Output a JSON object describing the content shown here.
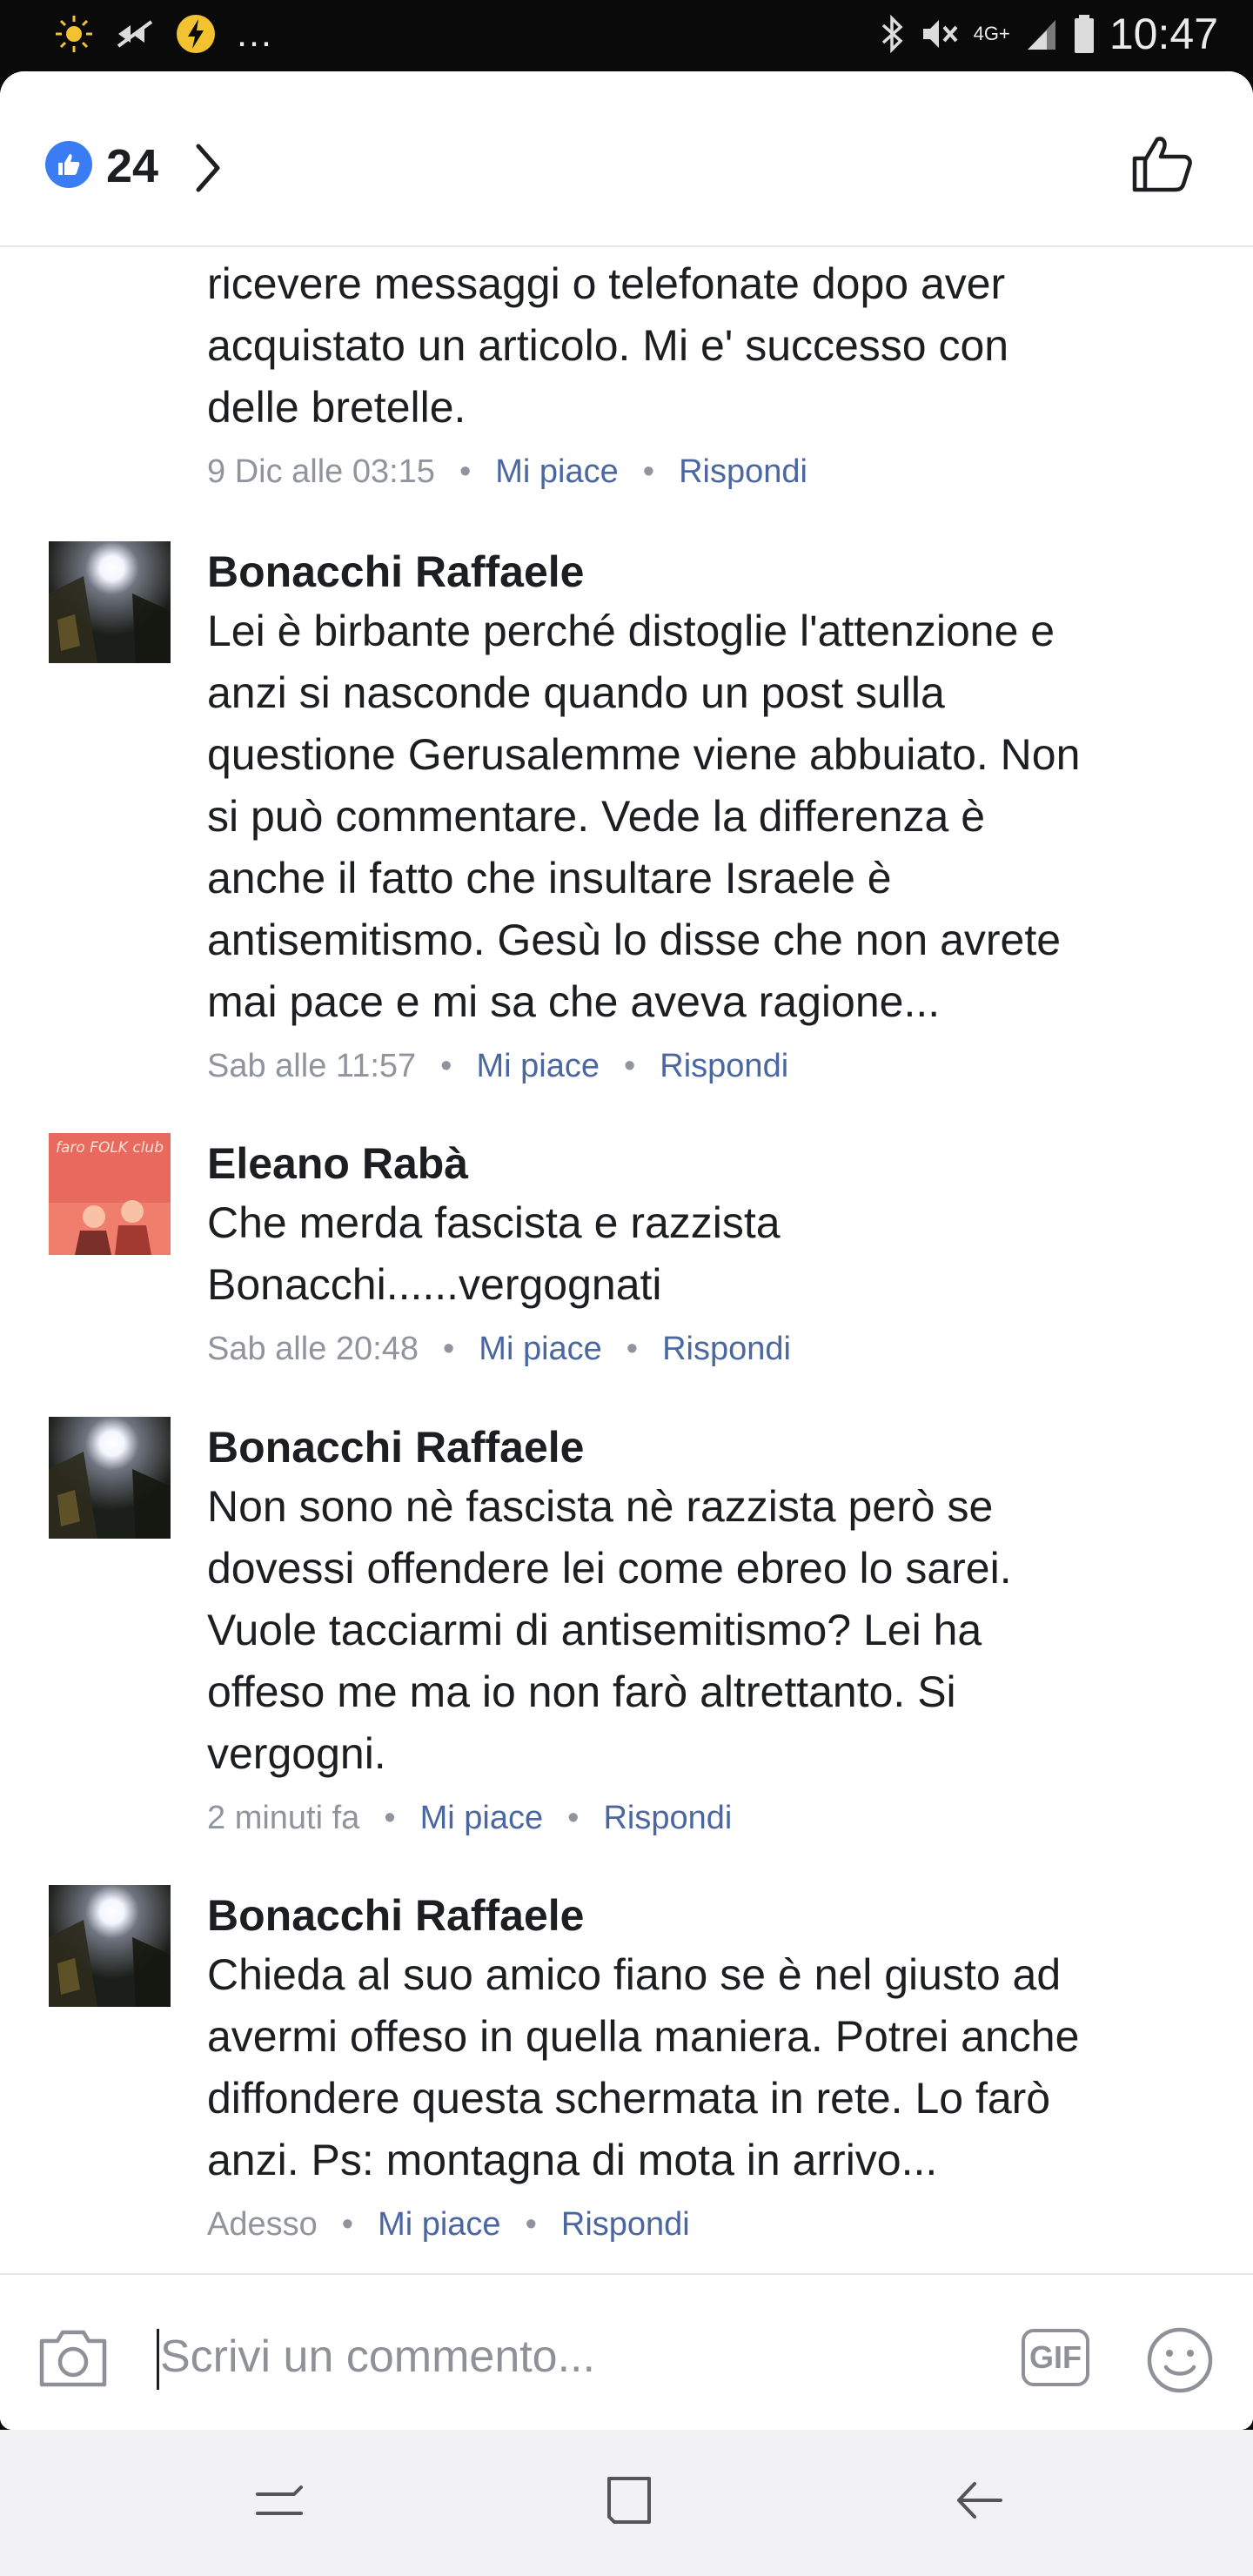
{
  "status_bar": {
    "network": "4G+",
    "time": "10:47"
  },
  "header": {
    "like_count": "24"
  },
  "comments": [
    {
      "text": "Non ho nulla da nascondere ma detesto\nricevere messaggi o telefonate dopo aver\nacquistato un articolo. Mi e' successo con\ndelle bretelle.",
      "time": "9 Dic alle 03:15",
      "like": "Mi piace",
      "reply": "Rispondi"
    },
    {
      "author": "Bonacchi Raffaele",
      "text": "Lei è birbante perché distoglie l'attenzione e\nanzi si nasconde quando un post sulla\nquestione Gerusalemme viene abbuiato. Non\nsi può commentare. Vede la differenza è\nanche il fatto che insultare Israele è\nantisemitismo. Gesù lo disse che non avrete\nmai pace e mi sa che aveva ragione...",
      "time": "Sab alle 11:57",
      "like": "Mi piace",
      "reply": "Rispondi"
    },
    {
      "author": "Eleano Rabà",
      "avatar_text": "faro FOLK club",
      "text": "Che merda fascista e razzista\nBonacchi......vergognati",
      "time": "Sab alle 20:48",
      "like": "Mi piace",
      "reply": "Rispondi"
    },
    {
      "author": "Bonacchi Raffaele",
      "text": "Non sono nè fascista nè razzista però se\ndovessi offendere lei come ebreo lo sarei.\nVuole tacciarmi di antisemitismo? Lei ha\noffeso me ma io non farò altrettanto. Si\nvergogni.",
      "time": "2 minuti fa",
      "like": "Mi piace",
      "reply": "Rispondi"
    },
    {
      "author": "Bonacchi Raffaele",
      "text": "Chieda al suo amico fiano se è nel giusto ad\navermi offeso in quella maniera. Potrei anche\ndiffondere questa schermata in rete. Lo farò\nanzi. Ps: montagna di mota in arrivo...",
      "time": "Adesso",
      "like": "Mi piace",
      "reply": "Rispondi"
    }
  ],
  "composer": {
    "placeholder": "Scrivi un commento...",
    "gif_label": "GIF"
  },
  "colors": {
    "like_blue": "#3b7cf4",
    "action_link": "#4b67a1",
    "meta_gray": "#90949c"
  },
  "icons": [
    "thumbs-up-icon",
    "chevron-right-icon",
    "camera-icon",
    "gif-icon",
    "smiley-icon",
    "recents-icon",
    "home-icon",
    "back-icon"
  ]
}
